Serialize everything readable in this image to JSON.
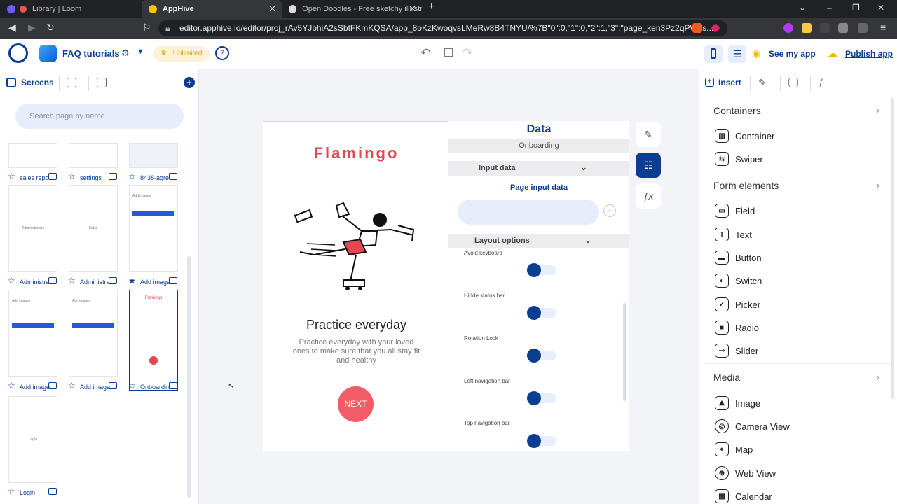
{
  "browser": {
    "tabs": [
      {
        "title": "Library | Loom"
      },
      {
        "title": "AppHive"
      },
      {
        "title": "Open Doodles - Free sketchy illustrati"
      }
    ],
    "url": "editor.apphive.io/editor/proj_rAv5YJbhiA2sSbtFKmKQSA/app_8oKzKwoqvsLMeRw8B4TNYU/%7B\"0\":0,\"1\":0,\"2\":1,\"3\":\"page_ken3Pz2qPWes..."
  },
  "appbar": {
    "project": "FAQ tutorials",
    "plan": "Unlimited",
    "see_app": "See my app",
    "publish": "Publish app"
  },
  "left": {
    "screens_tab": "Screens",
    "search_placeholder": "Search page by name",
    "thumbs": [
      {
        "label": "sales repo",
        "preview": ""
      },
      {
        "label": "settings",
        "preview": ""
      },
      {
        "label": "8438-agre",
        "preview": ""
      },
      {
        "label": "Administra",
        "preview": "Administrators"
      },
      {
        "label": "Administra",
        "preview": "Sales"
      },
      {
        "label": "Add image",
        "preview": "Add images"
      },
      {
        "label": "Add image",
        "preview": "Add images"
      },
      {
        "label": "Add image",
        "preview": "Add images"
      },
      {
        "label": "Onboardin",
        "preview": "Flamingo"
      },
      {
        "label": "Login",
        "preview": "Login"
      }
    ]
  },
  "phone": {
    "brand": "Flamingo",
    "heading": "Practice everyday",
    "body": "Practice everyday with your loved ones to make sure that you all stay fit and healthy",
    "button": "NEXT"
  },
  "data_panel": {
    "title": "Data",
    "subtitle": "Onboarding",
    "input_section": "Input data",
    "page_input": "Page input data",
    "layout_section": "Layout options",
    "toggles": [
      "Avoid keyboard",
      "Hidde status bar",
      "Rotation Lock",
      "Left navigation bar",
      "Top navigation bar"
    ]
  },
  "right": {
    "insert": "Insert",
    "groups": [
      {
        "title": "Containers",
        "items": [
          "Container",
          "Swiper"
        ]
      },
      {
        "title": "Form elements",
        "items": [
          "Field",
          "Text",
          "Button",
          "Switch",
          "Picker",
          "Radio",
          "Slider"
        ]
      },
      {
        "title": "Media",
        "items": [
          "Image",
          "Camera View",
          "Map",
          "Web View",
          "Calendar"
        ]
      }
    ]
  },
  "colors": {
    "accent": "#0b3d91",
    "brand": "#e4474f",
    "plan_bg": "#fdf2d8"
  }
}
